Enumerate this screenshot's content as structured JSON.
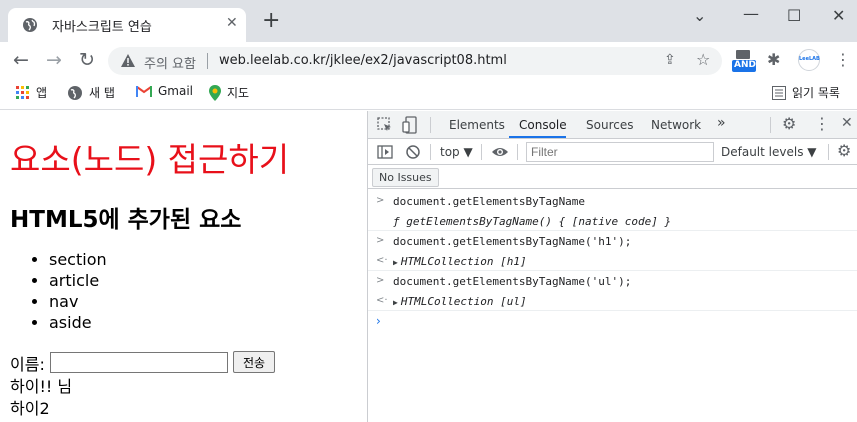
{
  "browser": {
    "tab_title": "자바스크립트 연습",
    "tab_close": "✕",
    "new_tab": "+",
    "window": {
      "minimize": "⌄",
      "restore": "—",
      "maximize": "☐",
      "close": "✕"
    },
    "security_label": "주의 요함",
    "url": "web.leelab.co.kr/jklee/ex2/javascript08.html",
    "ext_badge": "AND",
    "profile_label": "LeeLAB",
    "bookmarks": [
      {
        "label": "앱"
      },
      {
        "label": "새 탭"
      },
      {
        "label": "Gmail"
      },
      {
        "label": "지도"
      }
    ],
    "reading_list": "읽기 목록"
  },
  "page": {
    "h1": "요소(노드) 접근하기",
    "h2": "HTML5에 추가된 요소",
    "list": [
      "section",
      "article",
      "nav",
      "aside"
    ],
    "name_label": "이름:",
    "name_value": "",
    "submit_label": "전송",
    "output_1": "하이!! 님",
    "output_2": "하이2"
  },
  "devtools": {
    "tabs": [
      "Elements",
      "Console",
      "Sources",
      "Network"
    ],
    "active_tab": "Console",
    "more_tabs": "»",
    "context": "top",
    "filter_placeholder": "Filter",
    "levels": "Default levels ▼",
    "issues": "No Issues",
    "console_lines": [
      {
        "kind": "input",
        "gutter": ">",
        "text": "document.getElementsByTagName"
      },
      {
        "kind": "result",
        "gutter": "",
        "text": "ƒ getElementsByTagName() { [native code] }"
      },
      {
        "kind": "input",
        "gutter": ">",
        "text": "document.getElementsByTagName('h1');"
      },
      {
        "kind": "result",
        "gutter": "<·",
        "caret": "▶",
        "text": "HTMLCollection [h1]"
      },
      {
        "kind": "input",
        "gutter": ">",
        "text": "document.getElementsByTagName('ul');"
      },
      {
        "kind": "result",
        "gutter": "<·",
        "caret": "▶",
        "text": "HTMLCollection [ul]"
      }
    ],
    "prompt": "›"
  }
}
